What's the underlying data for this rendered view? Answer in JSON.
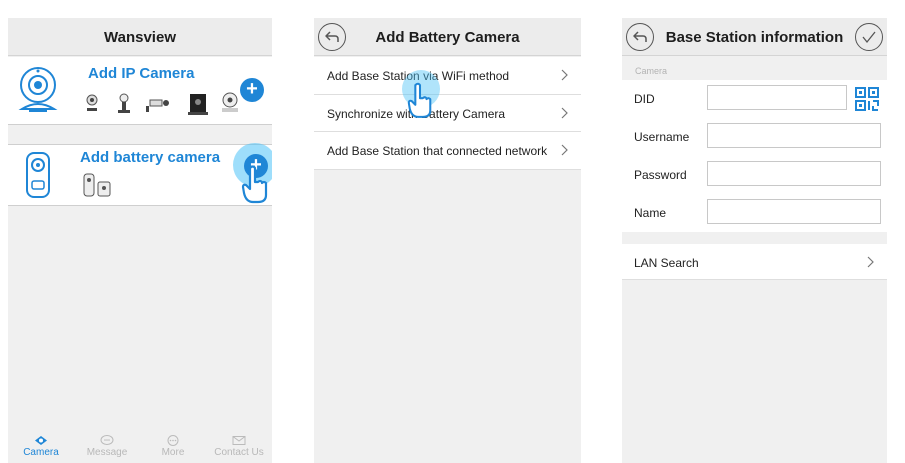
{
  "screen1": {
    "title": "Wansview",
    "ip_card": {
      "title": "Add IP Camera",
      "add_label": "+"
    },
    "battery_card": {
      "title": "Add battery camera",
      "add_label": "+"
    },
    "tabs": [
      {
        "label": "Camera",
        "icon": "camera-icon",
        "active": true
      },
      {
        "label": "Message",
        "icon": "message-icon",
        "active": false
      },
      {
        "label": "More",
        "icon": "more-icon",
        "active": false
      },
      {
        "label": "Contact Us",
        "icon": "contact-icon",
        "active": false
      }
    ],
    "colors": {
      "accent": "#1f86d6",
      "tap_glow": "#4fc3f7"
    }
  },
  "screen2": {
    "title": "Add Battery Camera",
    "items": [
      {
        "label": "Add Base Station via WiFi method"
      },
      {
        "label": "Synchronize with Battery Camera"
      },
      {
        "label": "Add Base Station that connected network"
      }
    ]
  },
  "screen3": {
    "title": "Base Station information",
    "section": "Camera",
    "fields": [
      {
        "label": "DID",
        "value": ""
      },
      {
        "label": "Username",
        "value": ""
      },
      {
        "label": "Password",
        "value": ""
      },
      {
        "label": "Name",
        "value": ""
      }
    ],
    "lan_search": "LAN Search"
  }
}
